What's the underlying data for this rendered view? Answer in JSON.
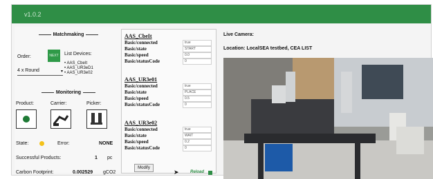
{
  "app": {
    "version": "v1.0.2"
  },
  "matchmaking": {
    "title": "Matchmaking",
    "order_label": "Order:",
    "order_button": "NEXT",
    "devices_label": "List Devices:",
    "devices": [
      "AAS_CbeIt",
      "AAS_UR3eD1",
      "AAS_UR3e02"
    ],
    "strategy": "4 x Round"
  },
  "monitoring": {
    "title": "Monitoring",
    "product_label": "Product:",
    "carrier_label": "Carrier:",
    "picker_label": "Picker:",
    "state_label": "State:",
    "error_label": "Error:",
    "error_value": "NONE",
    "successful_label": "Successful Products:",
    "successful_value": "1",
    "successful_unit": "pc",
    "carbon_label": "Carbon Footprint:",
    "carbon_value": "0.002529",
    "carbon_unit": "gCO2",
    "state_color": "#f4c21a"
  },
  "devices_panel": [
    {
      "name": "AAS_CbeIt",
      "fields": [
        {
          "key": "Basic/connected",
          "value": "true"
        },
        {
          "key": "Basic/state",
          "value": "START"
        },
        {
          "key": "Basic/speed",
          "value": "0.0"
        },
        {
          "key": "Basic/statusCode",
          "value": "0"
        }
      ]
    },
    {
      "name": "AAS_UR3e01",
      "fields": [
        {
          "key": "Basic/connected",
          "value": "true"
        },
        {
          "key": "Basic/state",
          "value": "PLACE"
        },
        {
          "key": "Basic/speed",
          "value": "0.5"
        },
        {
          "key": "Basic/statusCode",
          "value": "0"
        }
      ]
    },
    {
      "name": "AAS_UR3e02",
      "fields": [
        {
          "key": "Basic/connected",
          "value": "true"
        },
        {
          "key": "Basic/state",
          "value": "WAIT"
        },
        {
          "key": "Basic/speed",
          "value": "0.2"
        },
        {
          "key": "Basic/statusCode",
          "value": "0"
        }
      ]
    }
  ],
  "modify_label": "Modify",
  "reload_label": "Reload",
  "camera": {
    "title": "Live Camera:",
    "location": "Location: LocalSEA testbed, CEA LIST"
  },
  "colors": {
    "brand": "#2f8e46"
  }
}
